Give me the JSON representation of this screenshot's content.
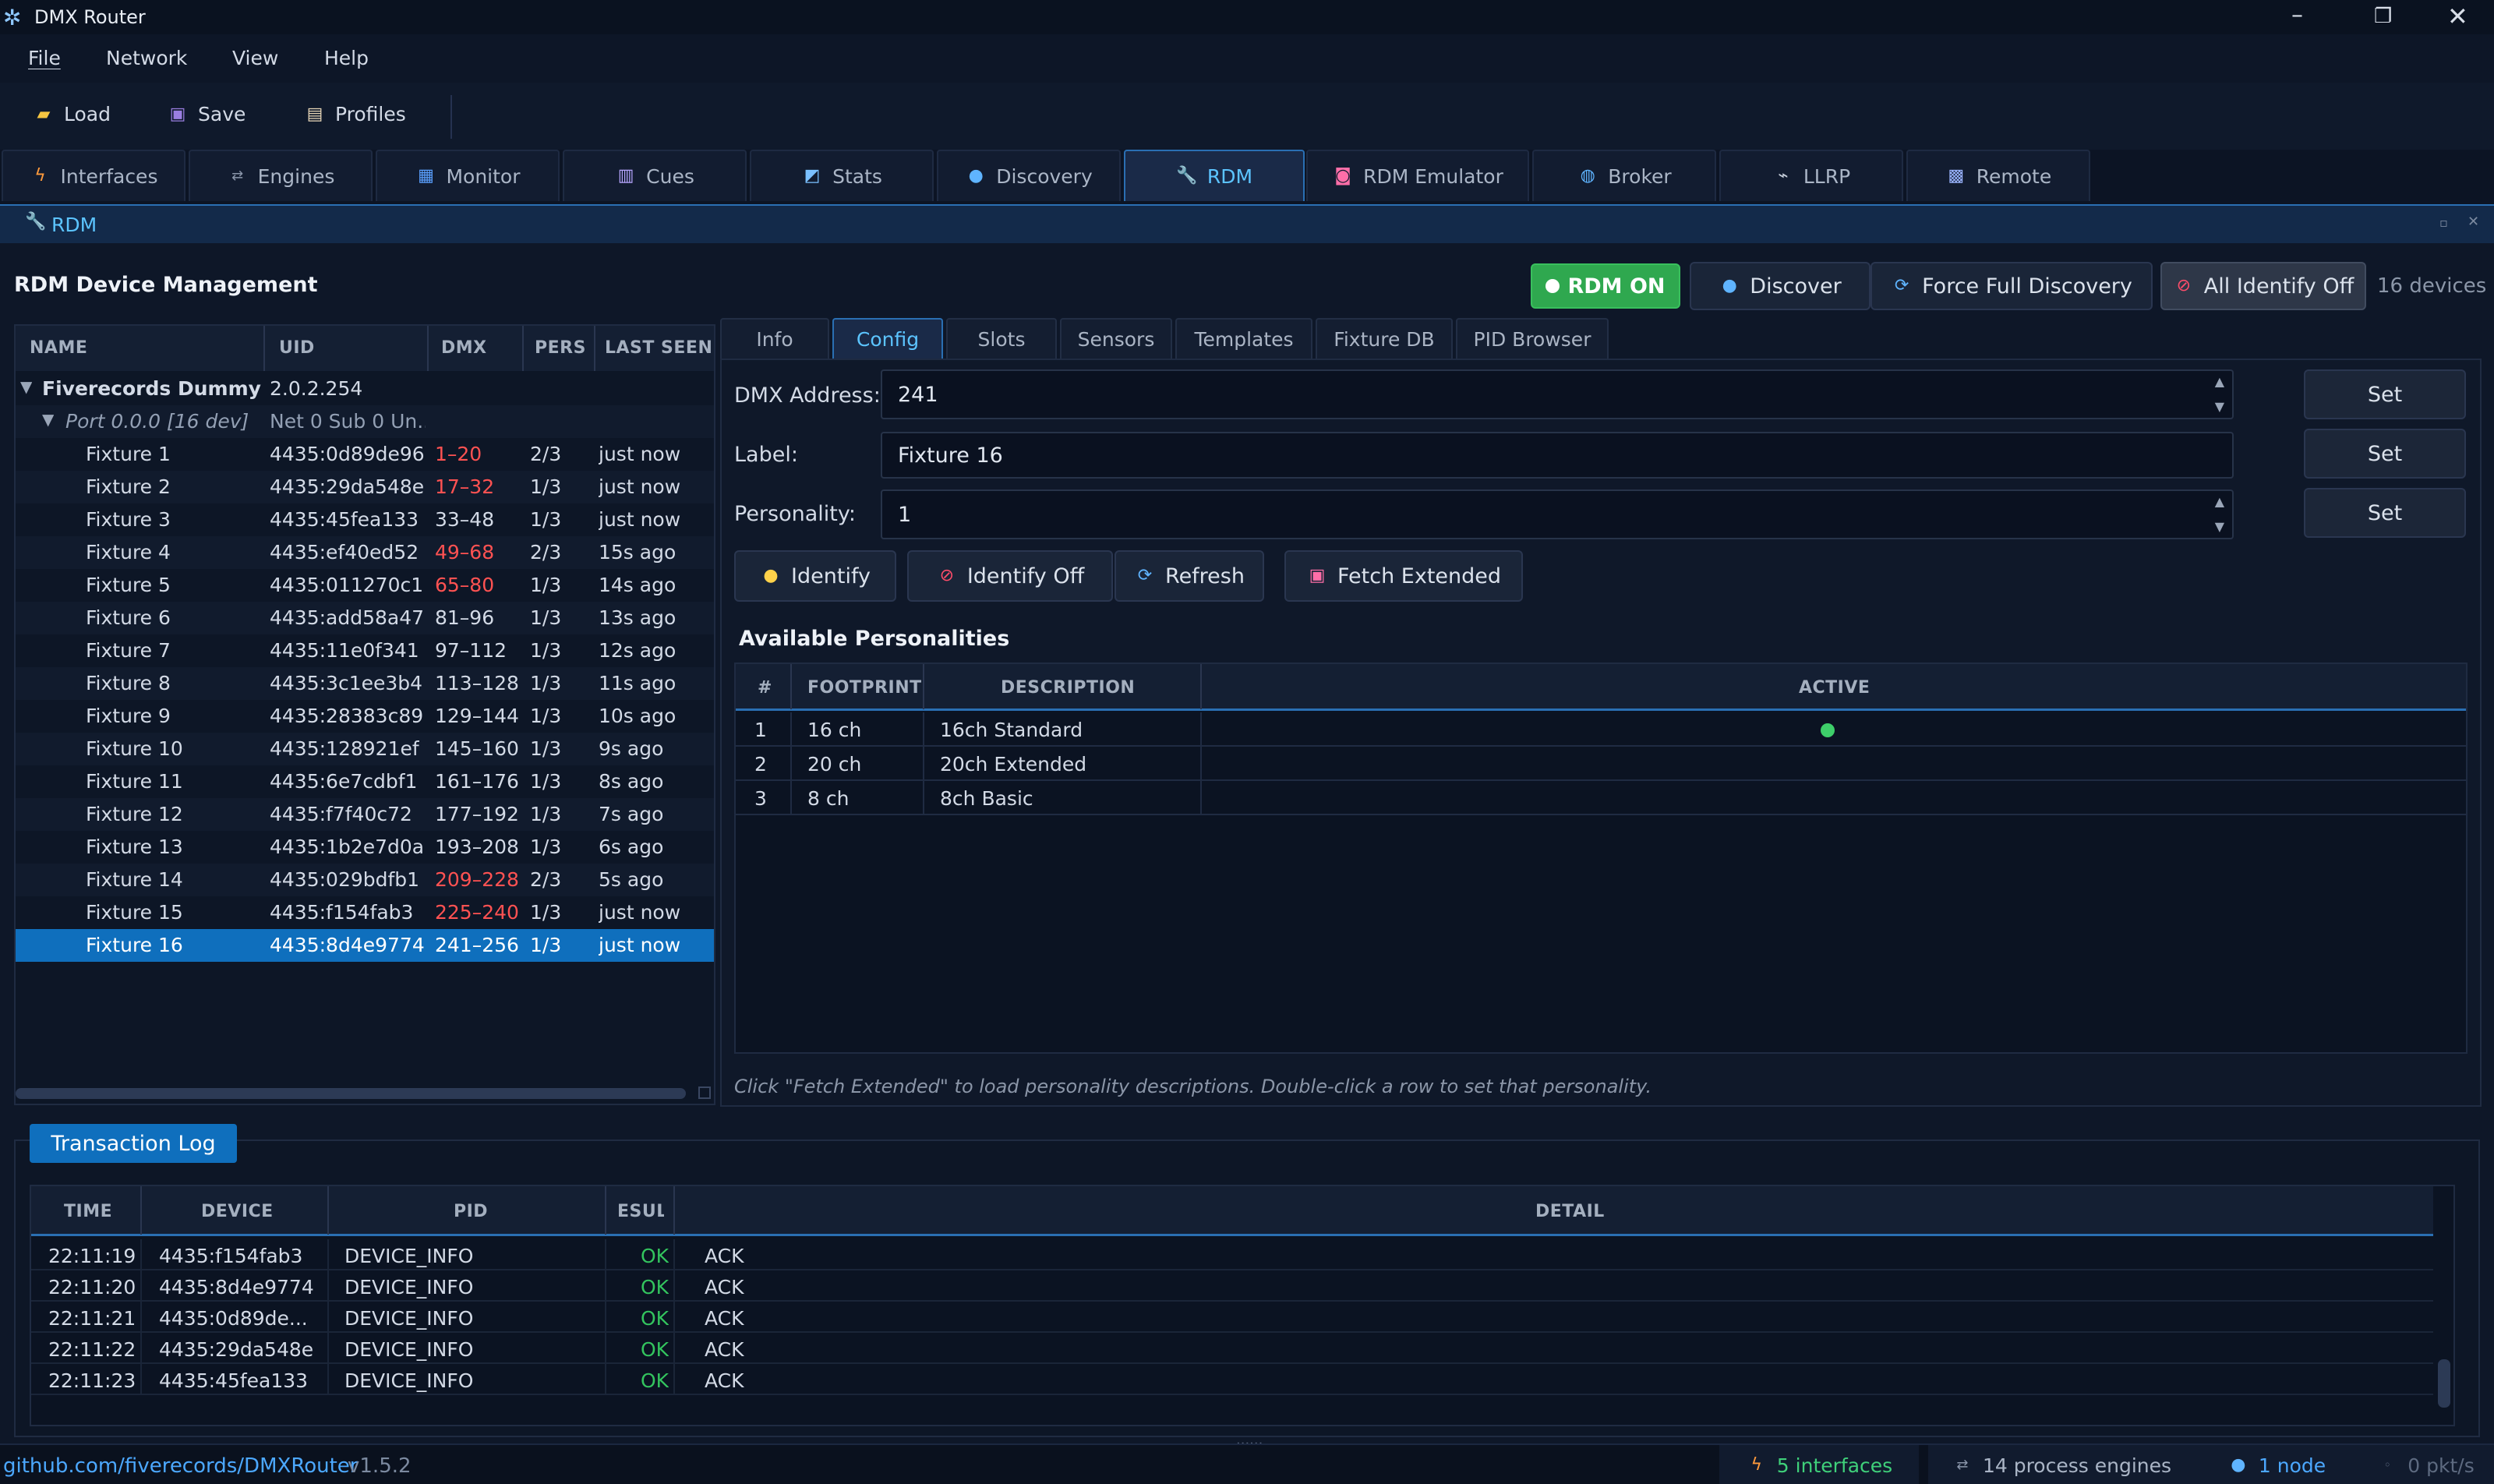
{
  "window": {
    "title": "DMX Router"
  },
  "menu": [
    "File",
    "Network",
    "View",
    "Help"
  ],
  "toolbar": {
    "load": "Load",
    "save": "Save",
    "profiles": "Profiles"
  },
  "tabs": [
    "Interfaces",
    "Engines",
    "Monitor",
    "Cues",
    "Stats",
    "Discovery",
    "RDM",
    "RDM Emulator",
    "Broker",
    "LLRP",
    "Remote"
  ],
  "panel": {
    "title": "RDM"
  },
  "rdm": {
    "heading": "RDM Device Management",
    "rdm_on": "RDM ON",
    "discover": "Discover",
    "force": "Force Full Discovery",
    "identify_off_all": "All Identify Off",
    "device_count": "16 devices"
  },
  "tree": {
    "headers": [
      "NAME",
      "UID",
      "DMX",
      "PERS",
      "LAST SEEN"
    ],
    "root": {
      "name": "Fiverecords Dummy ...",
      "uid": "2.0.2.254"
    },
    "port": {
      "name": "Port 0.0.0  [16 dev]",
      "uid": "Net 0 Sub 0 Un..."
    },
    "fixtures": [
      {
        "name": "Fixture 1",
        "uid": "4435:0d89de96",
        "dmx": "1–20",
        "pers": "2/3",
        "seen": "just now",
        "warn": true
      },
      {
        "name": "Fixture 2",
        "uid": "4435:29da548e",
        "dmx": "17–32",
        "pers": "1/3",
        "seen": "just now",
        "warn": true
      },
      {
        "name": "Fixture 3",
        "uid": "4435:45fea133",
        "dmx": "33–48",
        "pers": "1/3",
        "seen": "just now",
        "warn": false
      },
      {
        "name": "Fixture 4",
        "uid": "4435:ef40ed52",
        "dmx": "49–68",
        "pers": "2/3",
        "seen": "15s ago",
        "warn": true
      },
      {
        "name": "Fixture 5",
        "uid": "4435:011270c1",
        "dmx": "65–80",
        "pers": "1/3",
        "seen": "14s ago",
        "warn": true
      },
      {
        "name": "Fixture 6",
        "uid": "4435:add58a47",
        "dmx": "81–96",
        "pers": "1/3",
        "seen": "13s ago",
        "warn": false
      },
      {
        "name": "Fixture 7",
        "uid": "4435:11e0f341",
        "dmx": "97–112",
        "pers": "1/3",
        "seen": "12s ago",
        "warn": false
      },
      {
        "name": "Fixture 8",
        "uid": "4435:3c1ee3b4",
        "dmx": "113–128",
        "pers": "1/3",
        "seen": "11s ago",
        "warn": false
      },
      {
        "name": "Fixture 9",
        "uid": "4435:28383c89",
        "dmx": "129–144",
        "pers": "1/3",
        "seen": "10s ago",
        "warn": false
      },
      {
        "name": "Fixture 10",
        "uid": "4435:128921ef",
        "dmx": "145–160",
        "pers": "1/3",
        "seen": "9s ago",
        "warn": false
      },
      {
        "name": "Fixture 11",
        "uid": "4435:6e7cdbf1",
        "dmx": "161–176",
        "pers": "1/3",
        "seen": "8s ago",
        "warn": false
      },
      {
        "name": "Fixture 12",
        "uid": "4435:f7f40c72",
        "dmx": "177–192",
        "pers": "1/3",
        "seen": "7s ago",
        "warn": false
      },
      {
        "name": "Fixture 13",
        "uid": "4435:1b2e7d0a",
        "dmx": "193–208",
        "pers": "1/3",
        "seen": "6s ago",
        "warn": false
      },
      {
        "name": "Fixture 14",
        "uid": "4435:029bdfb1",
        "dmx": "209–228",
        "pers": "2/3",
        "seen": "5s ago",
        "warn": true
      },
      {
        "name": "Fixture 15",
        "uid": "4435:f154fab3",
        "dmx": "225–240",
        "pers": "1/3",
        "seen": "just now",
        "warn": true
      },
      {
        "name": "Fixture 16",
        "uid": "4435:8d4e9774",
        "dmx": "241–256",
        "pers": "1/3",
        "seen": "just now",
        "warn": false
      }
    ]
  },
  "config_tabs": [
    "Info",
    "Config",
    "Slots",
    "Sensors",
    "Templates",
    "Fixture DB",
    "PID Browser"
  ],
  "config": {
    "dmx_label": "DMX Address:",
    "dmx_value": "241",
    "label_label": "Label:",
    "label_value": "Fixture 16",
    "pers_label": "Personality:",
    "pers_value": "1",
    "set": "Set",
    "identify": "Identify",
    "identify_off": "Identify Off",
    "refresh": "Refresh",
    "fetch": "Fetch Extended",
    "avail": "Available Personalities",
    "pers_headers": [
      "#",
      "FOOTPRINT",
      "DESCRIPTION",
      "ACTIVE"
    ],
    "personalities": [
      {
        "n": "1",
        "fp": "16 ch",
        "desc": "16ch Standard",
        "active": true
      },
      {
        "n": "2",
        "fp": "20 ch",
        "desc": "20ch Extended",
        "active": false
      },
      {
        "n": "3",
        "fp": "8 ch",
        "desc": "8ch Basic",
        "active": false
      }
    ],
    "hint": "Click \"Fetch Extended\" to load personality descriptions. Double-click a row to set that personality."
  },
  "log": {
    "title": "Transaction Log",
    "headers": [
      "TIME",
      "DEVICE",
      "PID",
      "ESUL",
      "DETAIL"
    ],
    "rows": [
      {
        "t": "22:11:19",
        "d": "4435:f154fab3",
        "p": "DEVICE_INFO",
        "r": "OK",
        "x": "ACK"
      },
      {
        "t": "22:11:20",
        "d": "4435:8d4e9774",
        "p": "DEVICE_INFO",
        "r": "OK",
        "x": "ACK"
      },
      {
        "t": "22:11:21",
        "d": "4435:0d89de...",
        "p": "DEVICE_INFO",
        "r": "OK",
        "x": "ACK"
      },
      {
        "t": "22:11:22",
        "d": "4435:29da548e",
        "p": "DEVICE_INFO",
        "r": "OK",
        "x": "ACK"
      },
      {
        "t": "22:11:23",
        "d": "4435:45fea133",
        "p": "DEVICE_INFO",
        "r": "OK",
        "x": "ACK"
      }
    ]
  },
  "status": {
    "link": "github.com/fiverecords/DMXRouter",
    "version": "v1.5.2",
    "interfaces": "5 interfaces",
    "engines": "14 process engines",
    "node": "1 node",
    "pkt": "0 pkt/s"
  },
  "colors": {
    "accent": "#2a6fb3",
    "selected": "#0f6fbd",
    "ok": "#33c45e",
    "warn": "#ff5252",
    "rdm_on": "#2fa84f"
  }
}
